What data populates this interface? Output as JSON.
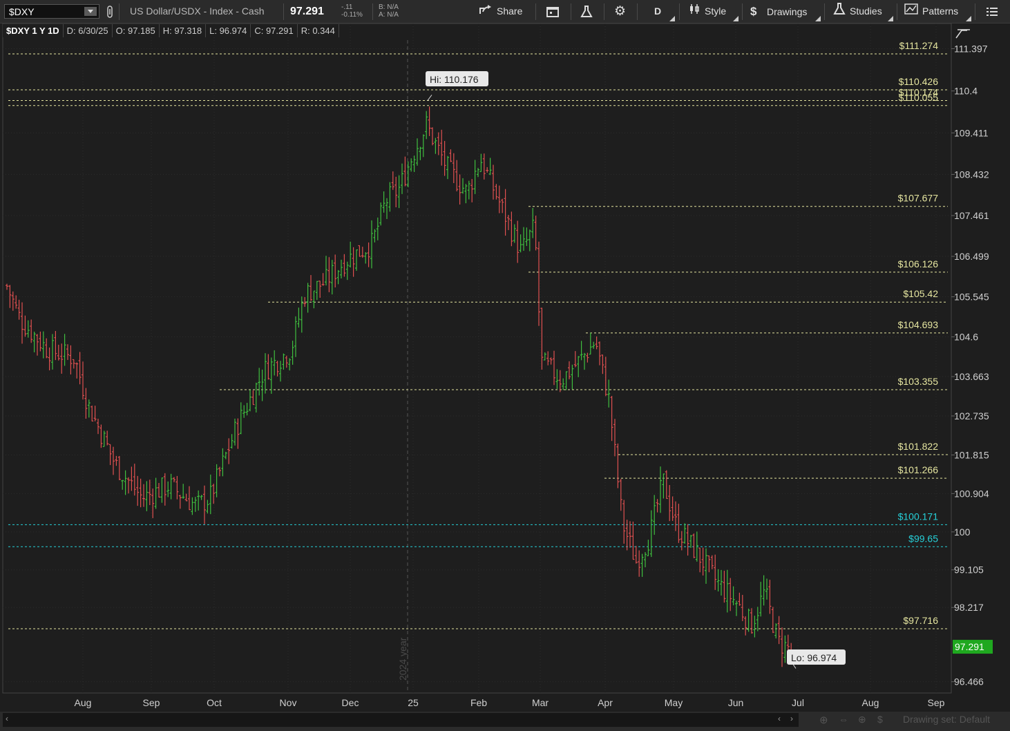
{
  "toolbar": {
    "symbol": "$DXY",
    "description": "US Dollar/USDX - Index - Cash",
    "last": "97.291",
    "change_net": "-.11",
    "change_pct": "-0.11%",
    "bid": "B: N/A",
    "ask": "A: N/A",
    "share_label": "Share",
    "timeframe": "D",
    "style_label": "Style",
    "drawings_label": "Drawings",
    "studies_label": "Studies",
    "patterns_label": "Patterns"
  },
  "infobar": {
    "title": "$DXY 1 Y 1D",
    "date": "D: 6/30/25",
    "open": "O: 97.185",
    "high": "H: 97.318",
    "low": "L: 96.974",
    "close": "C: 97.291",
    "range": "R: 0.344"
  },
  "bottombar": {
    "drawing_set": "Drawing set: Default"
  },
  "colors": {
    "background": "#1e1e1e",
    "up_bar": "#3fbf3f",
    "down_bar": "#e05050",
    "yellow_level": "#e6e6a0",
    "cyan_level": "#26d0d8",
    "last_price": "#1fa81f"
  },
  "chart_data": {
    "type": "ohlc",
    "x_ticks": [
      "Aug",
      "Sep",
      "Oct",
      "Nov",
      "Dec",
      "25",
      "Feb",
      "Mar",
      "Apr",
      "May",
      "Jun",
      "Jul",
      "Aug",
      "Sep"
    ],
    "y_ticks": [
      111.397,
      110.4,
      109.411,
      108.432,
      107.461,
      106.499,
      105.545,
      104.6,
      103.663,
      102.735,
      101.815,
      100.904,
      100,
      99.105,
      98.217,
      96.466
    ],
    "ylim": [
      96.2,
      111.6
    ],
    "year_marker": "2024 year",
    "high_label": "Hi: 110.176",
    "low_label": "Lo: 96.974",
    "last_price": "97.291",
    "levels": [
      {
        "label": "$111.274",
        "value": 111.274,
        "color": "yellow"
      },
      {
        "label": "$110.426",
        "value": 110.426,
        "color": "yellow"
      },
      {
        "label": "$110.174",
        "value": 110.174,
        "color": "yellow"
      },
      {
        "label": "$110.055",
        "value": 110.055,
        "color": "yellow"
      },
      {
        "label": "$107.677",
        "value": 107.677,
        "color": "yellow"
      },
      {
        "label": "$106.126",
        "value": 106.126,
        "color": "yellow"
      },
      {
        "label": "$105.42",
        "value": 105.42,
        "color": "yellow"
      },
      {
        "label": "$104.693",
        "value": 104.693,
        "color": "yellow"
      },
      {
        "label": "$103.355",
        "value": 103.355,
        "color": "yellow"
      },
      {
        "label": "$101.822",
        "value": 101.822,
        "color": "yellow"
      },
      {
        "label": "$101.266",
        "value": 101.266,
        "color": "yellow"
      },
      {
        "label": "$100.171",
        "value": 100.171,
        "color": "cyan"
      },
      {
        "label": "$99.65",
        "value": 99.65,
        "color": "cyan"
      },
      {
        "label": "$97.716",
        "value": 97.716,
        "color": "yellow"
      }
    ],
    "close_path": [
      [
        0,
        105.8
      ],
      [
        0.02,
        105.0
      ],
      [
        0.06,
        104.3
      ],
      [
        0.1,
        104.1
      ],
      [
        0.12,
        103.0
      ],
      [
        0.16,
        101.6
      ],
      [
        0.2,
        100.8
      ],
      [
        0.24,
        101.1
      ],
      [
        0.28,
        100.6
      ],
      [
        0.3,
        100.8
      ],
      [
        0.34,
        102.5
      ],
      [
        0.38,
        103.8
      ],
      [
        0.42,
        104.3
      ],
      [
        0.44,
        105.6
      ],
      [
        0.47,
        105.9
      ],
      [
        0.5,
        106.4
      ],
      [
        0.54,
        106.8
      ],
      [
        0.56,
        107.8
      ],
      [
        0.58,
        108.1
      ],
      [
        0.6,
        108.9
      ],
      [
        0.62,
        109.6
      ],
      [
        0.65,
        108.6
      ],
      [
        0.68,
        108.0
      ],
      [
        0.7,
        108.8
      ],
      [
        0.73,
        107.7
      ],
      [
        0.76,
        106.6
      ],
      [
        0.78,
        107.2
      ],
      [
        0.79,
        104.0
      ],
      [
        0.82,
        103.6
      ],
      [
        0.85,
        104.1
      ],
      [
        0.87,
        104.5
      ],
      [
        0.89,
        103.1
      ],
      [
        0.91,
        100.2
      ],
      [
        0.93,
        99.3
      ],
      [
        0.95,
        99.9
      ],
      [
        0.97,
        101.2
      ],
      [
        0.99,
        100.1
      ],
      [
        1.02,
        99.5
      ],
      [
        1.05,
        98.8
      ],
      [
        1.08,
        98.3
      ],
      [
        1.1,
        97.8
      ],
      [
        1.12,
        98.6
      ],
      [
        1.14,
        97.4
      ],
      [
        1.16,
        97.2
      ]
    ]
  }
}
